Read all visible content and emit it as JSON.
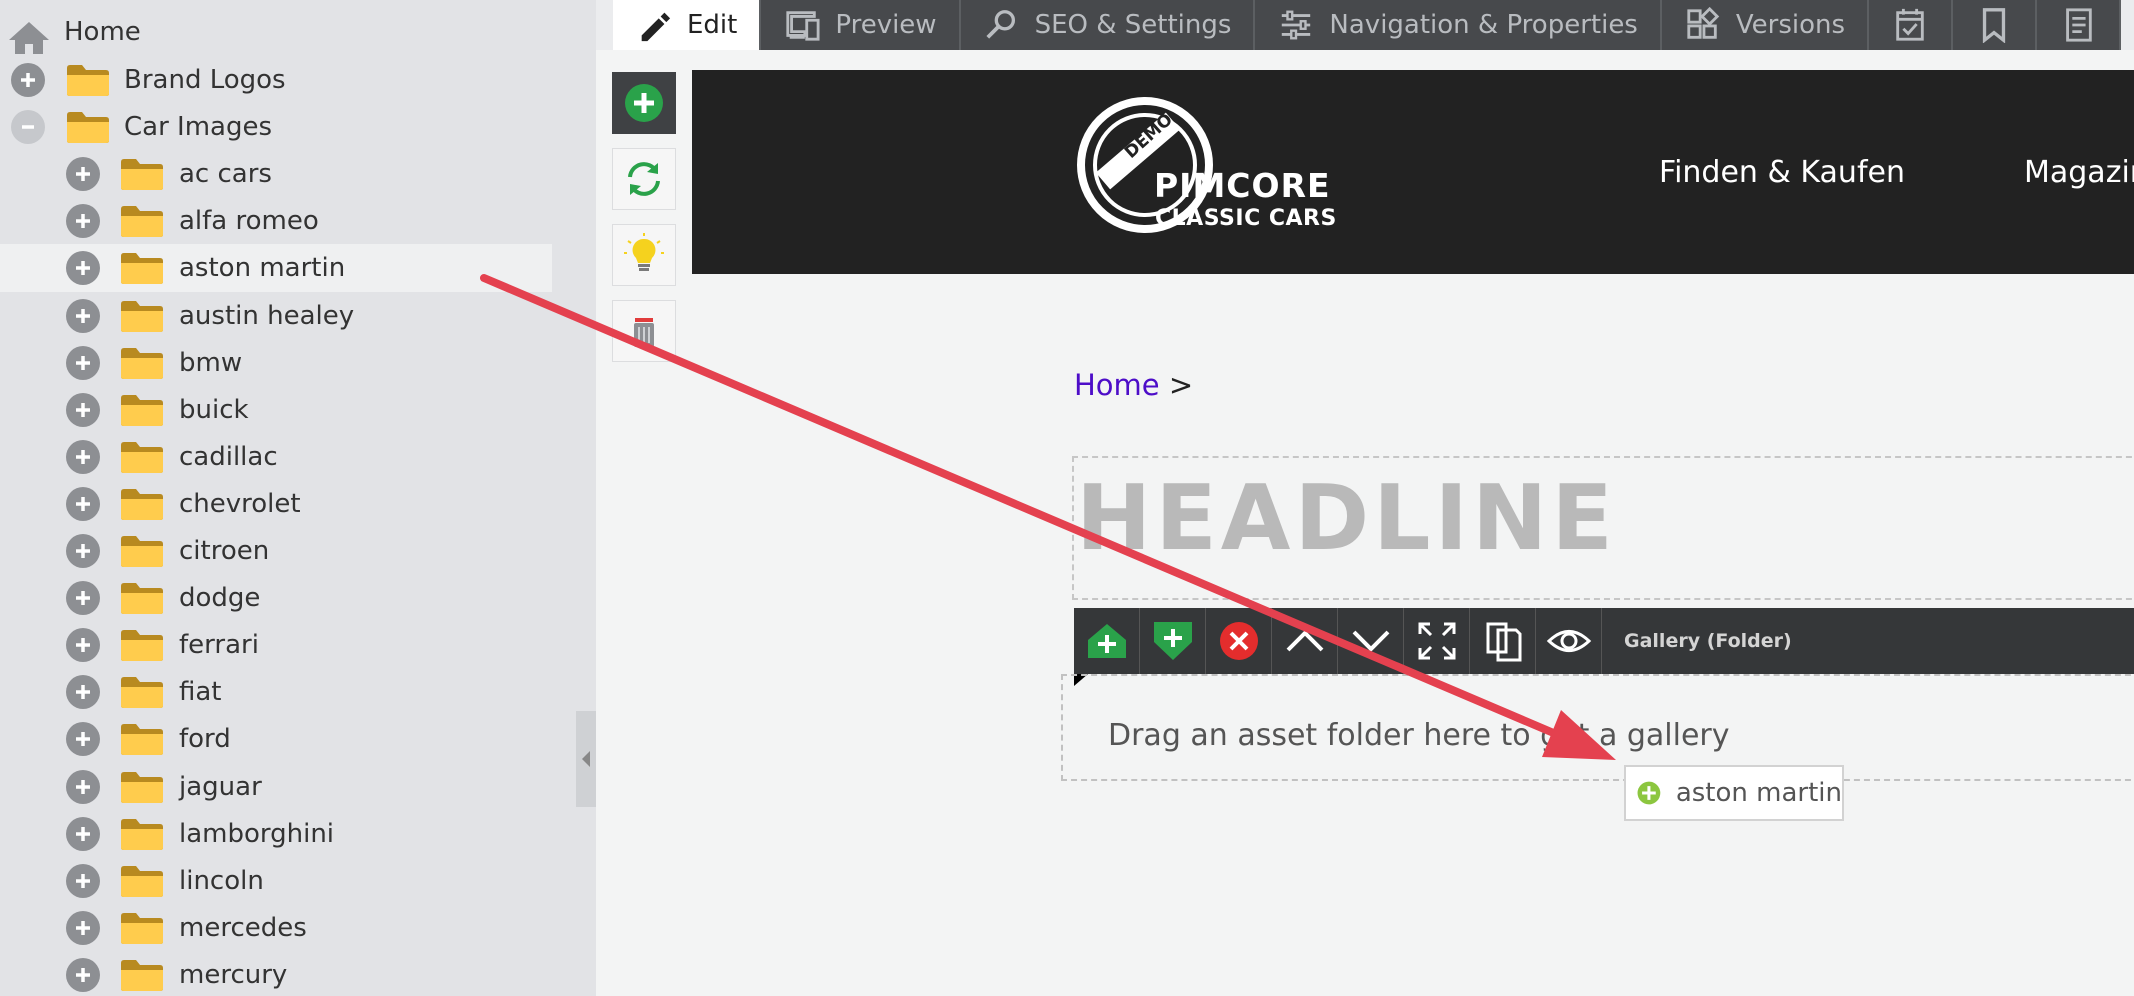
{
  "tree": {
    "home_label": "Home",
    "nodes": [
      {
        "label": "Brand Logos",
        "level": 1,
        "expander": "plus"
      },
      {
        "label": "Car Images",
        "level": 1,
        "expander": "minus"
      },
      {
        "label": "ac cars",
        "level": 2,
        "expander": "plus"
      },
      {
        "label": "alfa romeo",
        "level": 2,
        "expander": "plus"
      },
      {
        "label": "aston martin",
        "level": 2,
        "expander": "plus",
        "highlighted": true
      },
      {
        "label": "austin healey",
        "level": 2,
        "expander": "plus"
      },
      {
        "label": "bmw",
        "level": 2,
        "expander": "plus"
      },
      {
        "label": "buick",
        "level": 2,
        "expander": "plus"
      },
      {
        "label": "cadillac",
        "level": 2,
        "expander": "plus"
      },
      {
        "label": "chevrolet",
        "level": 2,
        "expander": "plus"
      },
      {
        "label": "citroen",
        "level": 2,
        "expander": "plus"
      },
      {
        "label": "dodge",
        "level": 2,
        "expander": "plus"
      },
      {
        "label": "ferrari",
        "level": 2,
        "expander": "plus"
      },
      {
        "label": "fiat",
        "level": 2,
        "expander": "plus"
      },
      {
        "label": "ford",
        "level": 2,
        "expander": "plus"
      },
      {
        "label": "jaguar",
        "level": 2,
        "expander": "plus"
      },
      {
        "label": "lamborghini",
        "level": 2,
        "expander": "plus"
      },
      {
        "label": "lincoln",
        "level": 2,
        "expander": "plus"
      },
      {
        "label": "mercedes",
        "level": 2,
        "expander": "plus"
      },
      {
        "label": "mercury",
        "level": 2,
        "expander": "plus"
      }
    ]
  },
  "tabs": [
    {
      "label": "Edit",
      "icon": "pencil-icon",
      "active": true
    },
    {
      "label": "Preview",
      "icon": "devices-icon"
    },
    {
      "label": "SEO & Settings",
      "icon": "magnifier-icon"
    },
    {
      "label": "Navigation & Properties",
      "icon": "sliders-icon"
    },
    {
      "label": "Versions",
      "icon": "blocks-icon"
    },
    {
      "label": "",
      "icon": "calendar-check-icon"
    },
    {
      "label": "",
      "icon": "bookmark-icon"
    },
    {
      "label": "",
      "icon": "document-icon"
    }
  ],
  "tools": [
    {
      "icon": "add-icon"
    },
    {
      "icon": "refresh-icon"
    },
    {
      "icon": "lightbulb-icon"
    },
    {
      "icon": "trash-icon"
    }
  ],
  "site": {
    "logo": {
      "badge": "DEMO",
      "word": "PIMCORE",
      "sub": "CLASSIC CARS"
    },
    "nav": [
      "Finden & Kaufen",
      "Magazin"
    ],
    "breadcrumb": {
      "home": "Home",
      "separator": ">"
    },
    "headline": "HEADLINE"
  },
  "area": {
    "buttons": [
      "add-above-icon",
      "add-below-icon",
      "remove-icon",
      "move-up-icon",
      "move-down-icon",
      "fullscreen-icon",
      "copy-icon",
      "visibility-icon"
    ],
    "title": "Gallery (Folder)",
    "drop_text": "Drag an asset folder here to get a gallery"
  },
  "drag_tooltip": {
    "label": "aston martin"
  },
  "colors": {
    "accent_green": "#2aa24a",
    "remove_red": "#e42d2d",
    "arrow_red": "#e4414f",
    "breadcrumb_link": "#4d0dc8"
  }
}
